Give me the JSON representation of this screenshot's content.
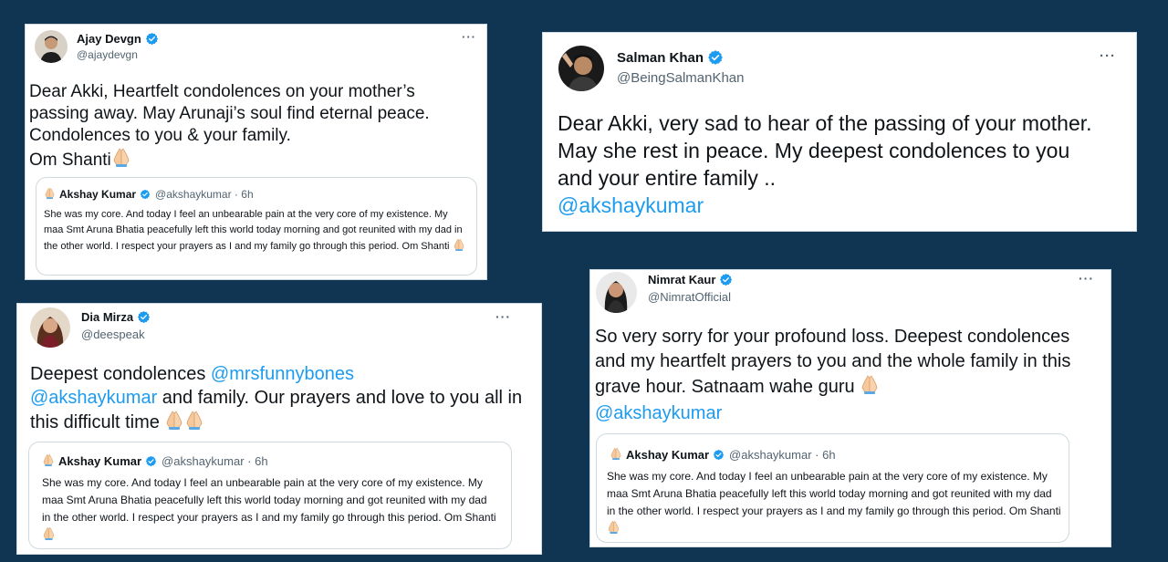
{
  "background_color": "#0f3553",
  "accent": "#1d9bf0",
  "quoted": {
    "name": "Akshay Kumar",
    "handle": "@akshaykumar",
    "separator": " · ",
    "time": "6h",
    "text": "She was my core. And today I feel an unbearable pain at the very core of my existence. My maa Smt Aruna Bhatia peacefully left this world today morning and got reunited with my dad in the other world. I respect your prayers as I and my family go through this period. Om Shanti"
  },
  "tweets": [
    {
      "name": "Ajay Devgn",
      "handle": "@ajaydevgn",
      "more": "···",
      "text": "Dear Akki, Heartfelt condolences on your mother’s passing away.  May Arunaji’s soul find eternal peace.\nCondolences to you & your family.\nOm Shanti"
    },
    {
      "name": "Salman Khan",
      "handle": "@BeingSalmanKhan",
      "more": "···",
      "text": "Dear Akki, very sad to hear of the passing of your mother. May she rest in peace. My deepest condolences to you and your entire family ..",
      "mention": "@akshaykumar"
    },
    {
      "name": "Dia Mirza",
      "handle": "@deespeak",
      "more": "···",
      "text_pre": "Deepest condolences ",
      "mention1": "@mrsfunnybones",
      "mention2": "@akshaykumar",
      "text_post": " and family. Our prayers and love to you all in this difficult time"
    },
    {
      "name": "Nimrat Kaur",
      "handle": "@NimratOfficial",
      "more": "···",
      "text": "So very sorry for your profound loss. Deepest condolences and my heartfelt prayers to you and the whole family in this grave hour. Satnaam wahe guru",
      "mention": "@akshaykumar"
    }
  ]
}
